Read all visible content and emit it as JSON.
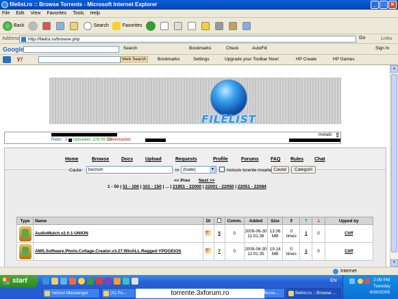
{
  "window": {
    "title": "filelist.ro :: Browse Torrents - Microsoft Internet Explorer",
    "min": "_",
    "max": "□",
    "close": "✕"
  },
  "menu": [
    "File",
    "Edit",
    "View",
    "Favorites",
    "Tools",
    "Help"
  ],
  "toolbar": {
    "back": "Back",
    "search": "Search",
    "favorites": "Favorites"
  },
  "address": {
    "label": "Address",
    "url": "http://filelist.ro/browse.php",
    "go": "Go",
    "links": "Links"
  },
  "google_bar": {
    "logo": "Google",
    "search": "Search",
    "bookmarks": "Bookmarks",
    "check": "Check",
    "autofill": "AutoFill",
    "signin": "Sign In"
  },
  "yahoo_bar": {
    "logo": "Y!",
    "web_search": "Web Search",
    "bookmarks": "Bookmarks",
    "settings": "Settings",
    "upgrade": "Upgrade your Toolbar Now!",
    "hp_create": "HP Create",
    "hp_games": "HP Games"
  },
  "site": {
    "logo": "FILELIST",
    "ratio_label": "Ratio:",
    "ratio_value": "3",
    "uploaded": "Uploaded: 229.09 GB",
    "downloaded": "Downloaded:",
    "invitatii_label": "Invitatii:",
    "invitatii_value": "0"
  },
  "nav": [
    "Home",
    "Browse",
    "Docs",
    "Upload",
    "Requests",
    "Profile",
    "Forums",
    "FAQ",
    "Rules",
    "Chat"
  ],
  "search": {
    "label": "Cauta:",
    "value": "burzum",
    "in_label": "in",
    "category": "(toate)",
    "dead_label": "inclusiv torente moarte",
    "submit": "Cauta!",
    "categories_btn": "Categorii"
  },
  "pager": {
    "prev": "<< Prev",
    "next": "Next >>",
    "current": "1 - 50",
    "pages": [
      "51 - 100",
      "101 - 150",
      "...",
      "21951 - 22000",
      "22001 - 22050",
      "22051 - 22084"
    ]
  },
  "table": {
    "headers": [
      "Type",
      "Name",
      "Dl",
      "",
      "Comm.",
      "Added",
      "Size",
      "",
      "",
      "",
      "Upped by"
    ],
    "rows": [
      {
        "name": "AudioMulch.v2.0.1-UNION",
        "files": "5",
        "comments": "0",
        "added_date": "2009-06-30",
        "added_time": "11:01:36",
        "size": "13.06",
        "size_unit": "MB",
        "snatched": "0",
        "snatched_unit": "times",
        "seeders": "1",
        "leechers": "0",
        "uploader": "Cliff"
      },
      {
        "name": "AMS.Software.Photo.Collage.Creator.v3.27.WinALL.Regged-YPOGEiOS",
        "files": "7",
        "comments": "0",
        "added_date": "2009-06-30",
        "added_time": "11:01:35",
        "size": "19.14",
        "size_unit": "MB",
        "snatched": "0",
        "snatched_unit": "times",
        "seeders": "1",
        "leechers": "0",
        "uploader": "Cliff"
      }
    ]
  },
  "status": {
    "zone": "Internet"
  },
  "taskbar": {
    "start": "start",
    "tasks": [
      "Yahoo! Messenger",
      "(X) Pu...",
      "GIVEAWAY - Micros...",
      "filelist.ro :: Browse ..."
    ],
    "lang": "EN",
    "time": "2:09 PM",
    "day": "Tuesday",
    "date": "6/30/2009"
  },
  "watermark": "torrente.3xforum.ro",
  "colors": {
    "titlebar": "#0842b0",
    "taskbar": "#2558d0",
    "start": "#2c8a24",
    "uploaded": "#1a9a1a",
    "downloaded": "#c02020"
  }
}
